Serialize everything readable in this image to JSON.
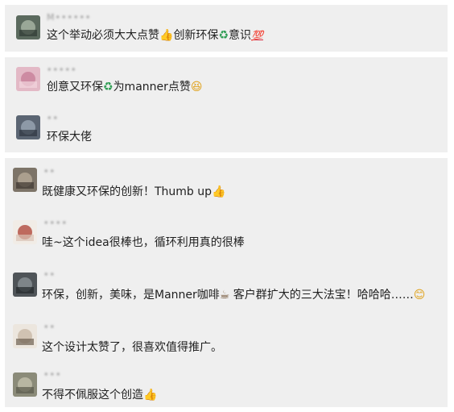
{
  "comments": [
    {
      "name": "M••••••",
      "text": "这个举动必须大大点赞",
      "emoji1": "👍",
      "text2": "创新环保",
      "emoji2": "♻",
      "text3": "意识",
      "emoji3": "💯",
      "avatar_color": "#5b6a5e"
    },
    {
      "name": "•••••",
      "text": "创意又环保",
      "emoji1": "♻",
      "text2": "为manner点赞",
      "emoji2": "😆",
      "avatar_color": "#d7a0b4"
    },
    {
      "name": "••",
      "text": "环保大佬",
      "avatar_color": "#5b6573"
    },
    {
      "name": "••",
      "text": "既健康又环保的创新！Thumb up",
      "emoji1": "👍",
      "avatar_color": "#7d7468"
    },
    {
      "name": "••••",
      "text": "哇~这个idea很棒也，循环利用真的很棒",
      "avatar_color": "#b24a3c"
    },
    {
      "name": "••",
      "text": "环保，创新，美味，是Manner咖啡",
      "emoji1": "☕",
      "text2": " 客户群扩大的三大法宝！哈哈哈……",
      "emoji2": "😊",
      "avatar_color": "#4f5458"
    },
    {
      "name": "••",
      "text": "这个设计太赞了，很喜欢值得推广。",
      "avatar_color": "#c9b9a6"
    },
    {
      "name": "•••",
      "text": "不得不佩服这个创造",
      "emoji1": "👍",
      "avatar_color": "#8b8b79"
    }
  ]
}
